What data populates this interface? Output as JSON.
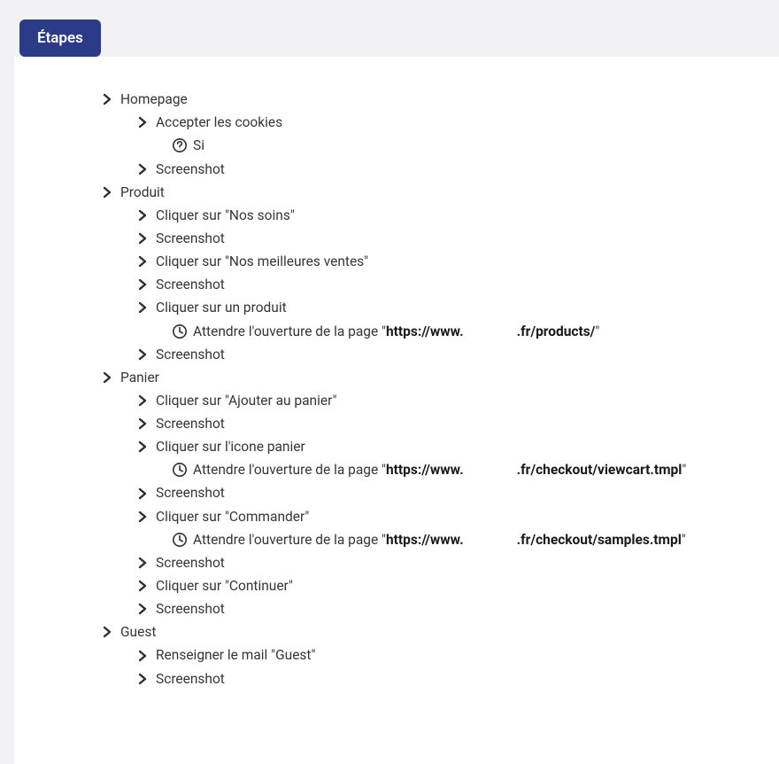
{
  "tab": {
    "label": "Étapes"
  },
  "steps": {
    "homepage": {
      "title": "Homepage",
      "accept_cookies": "Accepter les cookies",
      "si": "Si",
      "screenshot": "Screenshot"
    },
    "produit": {
      "title": "Produit",
      "click_nos_soins": "Cliquer sur \"Nos soins\"",
      "screenshot1": "Screenshot",
      "click_meilleures": "Cliquer sur \"Nos meilleures ventes\"",
      "screenshot2": "Screenshot",
      "click_produit": "Cliquer sur un produit",
      "wait_products_prefix": "Attendre l'ouverture de la page \"",
      "wait_products_host": "https://www.",
      "wait_products_path": ".fr/products/",
      "wait_products_suffix": "\"",
      "screenshot3": "Screenshot"
    },
    "panier": {
      "title": "Panier",
      "click_ajouter": "Cliquer sur \"Ajouter au panier\"",
      "screenshot1": "Screenshot",
      "click_icone": "Cliquer sur l'icone panier",
      "wait_viewcart_prefix": "Attendre l'ouverture de la page \"",
      "wait_viewcart_host": "https://www.",
      "wait_viewcart_path": ".fr/checkout/viewcart.tmpl",
      "wait_viewcart_suffix": "\"",
      "screenshot2": "Screenshot",
      "click_commander": "Cliquer sur \"Commander\"",
      "wait_samples_prefix": "Attendre l'ouverture de la page \"",
      "wait_samples_host": "https://www.",
      "wait_samples_path": ".fr/checkout/samples.tmpl",
      "wait_samples_suffix": "\"",
      "screenshot3": "Screenshot",
      "click_continuer": "Cliquer sur \"Continuer\"",
      "screenshot4": "Screenshot"
    },
    "guest": {
      "title": "Guest",
      "renseigner_mail": "Renseigner le mail \"Guest\"",
      "screenshot": "Screenshot"
    }
  }
}
